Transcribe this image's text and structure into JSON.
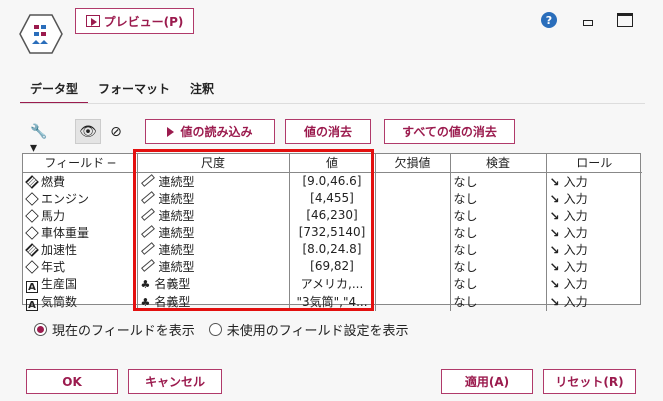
{
  "toolbar": {
    "preview_label": "プレビュー(P)"
  },
  "tabs": [
    {
      "label": "データ型"
    },
    {
      "label": "フォーマット"
    },
    {
      "label": "注釈"
    }
  ],
  "actions": {
    "read_values": "値の読み込み",
    "clear_values": "値の消去",
    "clear_all": "すべての値の消去"
  },
  "grid": {
    "headers": [
      "フィールド",
      "尺度",
      "値",
      "欠損値",
      "検査",
      "ロール"
    ],
    "rows": [
      {
        "field": "燃費",
        "icon": "diamond-striped",
        "measure": "連続型",
        "value": "[9.0,46.6]",
        "missing": "",
        "check": "なし",
        "role": "入力"
      },
      {
        "field": "エンジン",
        "icon": "diamond",
        "measure": "連続型",
        "value": "[4,455]",
        "missing": "",
        "check": "なし",
        "role": "入力"
      },
      {
        "field": "馬力",
        "icon": "diamond",
        "measure": "連続型",
        "value": "[46,230]",
        "missing": "",
        "check": "なし",
        "role": "入力"
      },
      {
        "field": "車体重量",
        "icon": "diamond",
        "measure": "連続型",
        "value": "[732,5140]",
        "missing": "",
        "check": "なし",
        "role": "入力"
      },
      {
        "field": "加速性",
        "icon": "diamond-striped",
        "measure": "連続型",
        "value": "[8.0,24.8]",
        "missing": "",
        "check": "なし",
        "role": "入力"
      },
      {
        "field": "年式",
        "icon": "diamond",
        "measure": "連続型",
        "value": "[69,82]",
        "missing": "",
        "check": "なし",
        "role": "入力"
      },
      {
        "field": "生産国",
        "icon": "text",
        "measure": "名義型",
        "value": "アメリカ,...",
        "missing": "",
        "check": "なし",
        "role": "入力"
      },
      {
        "field": "気筒数",
        "icon": "text",
        "measure": "名義型",
        "value": "\"3気筒\",\"4...",
        "missing": "",
        "check": "なし",
        "role": "入力"
      }
    ]
  },
  "options": {
    "show_current": "現在のフィールドを表示",
    "show_unused": "未使用のフィールド設定を表示"
  },
  "footer": {
    "ok": "OK",
    "cancel": "キャンセル",
    "apply": "適用(A)",
    "reset": "リセット(R)"
  },
  "colors": {
    "accent": "#9b1b4e",
    "highlight": "#e3100f"
  }
}
